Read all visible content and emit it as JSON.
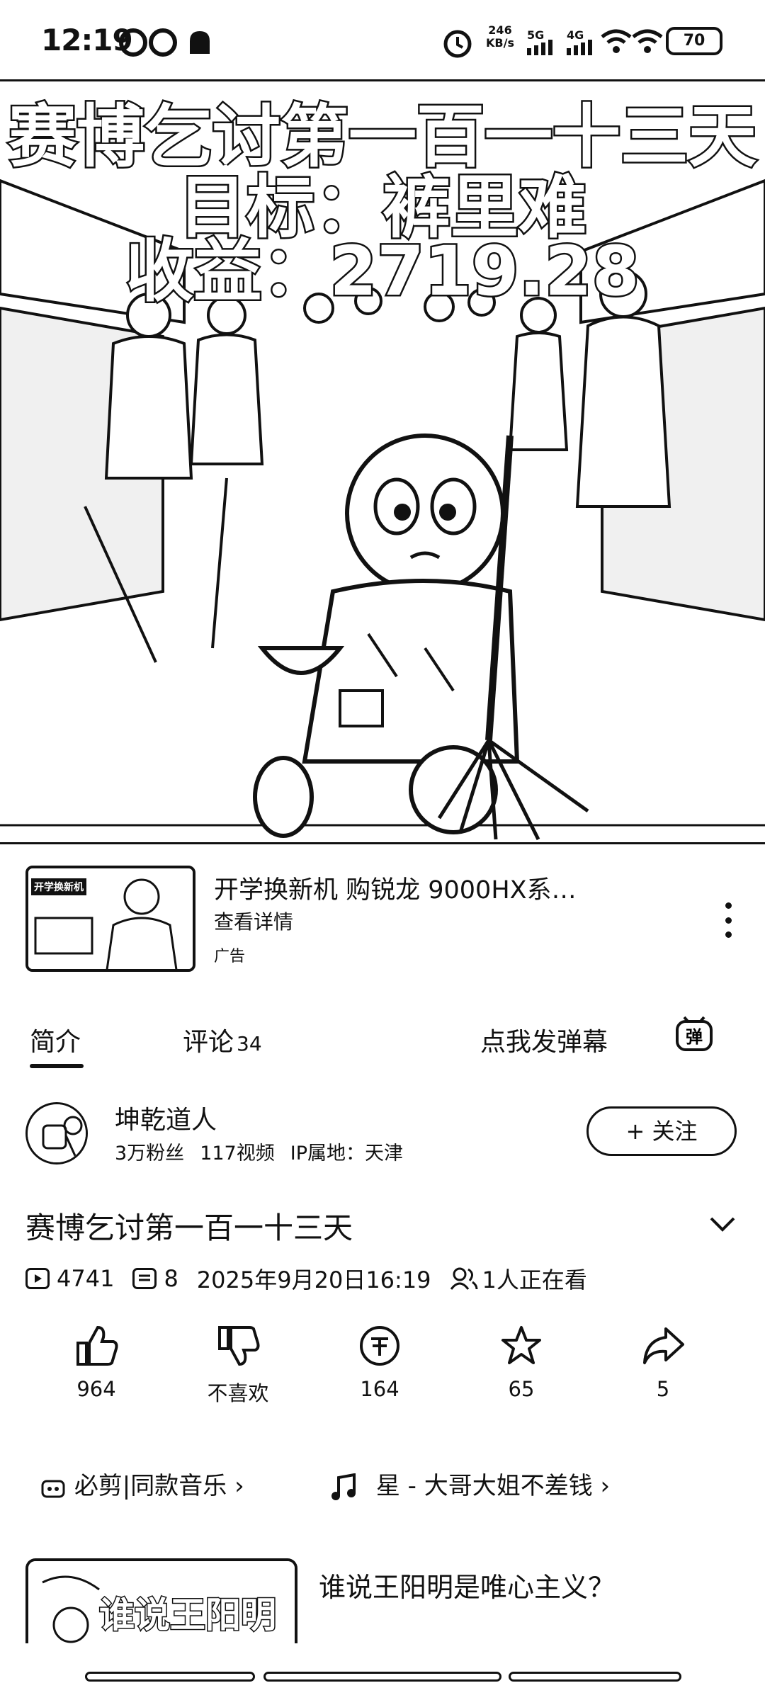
{
  "status_bar": {
    "time": "12:19",
    "net_rate_value": "246",
    "net_rate_unit": "KB/s",
    "sim1": "5G",
    "sim2": "4G",
    "battery": "70"
  },
  "video": {
    "overlay_line1": "赛博乞讨第一百一十三天",
    "overlay_line2": "目标：裤里难",
    "overlay_line3": "收益：2719.28"
  },
  "ad": {
    "thumb_label": "开学换新机",
    "title": "开学换新机 购锐龙 9000HX系…",
    "link": "查看详情",
    "tag": "广告"
  },
  "tabs": {
    "intro": "简介",
    "comments": "评论",
    "comments_count": "34",
    "danmu": "点我发弹幕",
    "danmu_icon_char": "弹"
  },
  "uploader": {
    "name": "坤乾道人",
    "fans": "3万粉丝",
    "videos": "117视频",
    "ip": "IP属地：天津",
    "follow": "+ 关注"
  },
  "video_info": {
    "title": "赛博乞讨第一百一十三天",
    "plays": "4741",
    "danmaku": "8",
    "datetime": "2025年9月20日16:19",
    "watching": "1人正在看"
  },
  "actions": {
    "like": "964",
    "dislike": "不喜欢",
    "coin": "164",
    "favorite": "65",
    "share": "5"
  },
  "music": {
    "bicut": "必剪|同款音乐",
    "song": "星 - 大哥大姐不差钱"
  },
  "recommend": {
    "thumb_text": "谁说王阳明",
    "title": "谁说王阳明是唯心主义？"
  }
}
